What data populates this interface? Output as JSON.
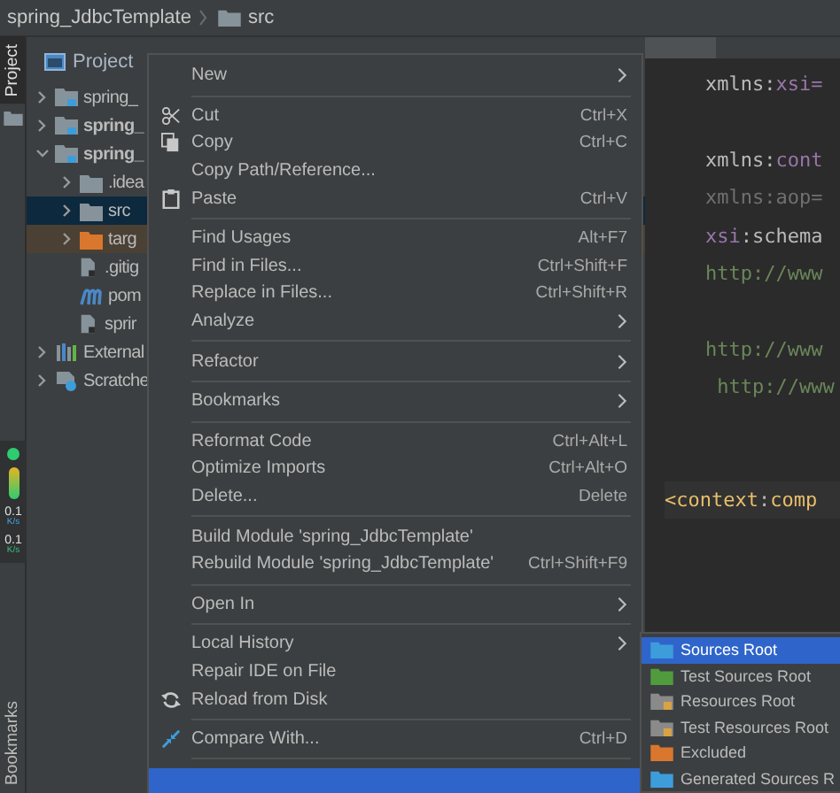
{
  "breadcrumb": [
    {
      "label": "spring_JdbcTemplate"
    },
    {
      "label": "src"
    }
  ],
  "side_strip": {
    "top_tab": {
      "label": "Project",
      "selected": true
    },
    "bottom_tab": {
      "label": "Bookmarks",
      "selected": false
    }
  },
  "net_widget": {
    "rates": [
      {
        "value": "0.1",
        "unit": "K/s"
      },
      {
        "value": "0.1",
        "unit": "K/s"
      }
    ]
  },
  "project_panel": {
    "title": "Project",
    "tree": [
      {
        "label": "spring_",
        "kind": "module",
        "bold": false,
        "expanded": false,
        "selected": false
      },
      {
        "label": "spring_",
        "kind": "module",
        "bold": true,
        "expanded": false,
        "selected": false
      },
      {
        "label": "spring_",
        "kind": "module",
        "bold": true,
        "expanded": true,
        "selected": false,
        "children": [
          {
            "label": ".idea",
            "kind": "folder",
            "bold": false,
            "expanded": false,
            "selected": false
          },
          {
            "label": "src",
            "kind": "folder",
            "bold": false,
            "expanded": false,
            "selected": true
          },
          {
            "label": "targ",
            "kind": "excluded",
            "bold": false,
            "expanded": false,
            "selected": false
          },
          {
            "label": ".gitig",
            "kind": "file",
            "bold": false,
            "selected": false
          },
          {
            "label": "pom",
            "kind": "maven",
            "bold": false,
            "selected": false
          },
          {
            "label": "sprir",
            "kind": "file",
            "bold": false,
            "selected": false
          }
        ]
      },
      {
        "label": "External",
        "kind": "libraries",
        "bold": false,
        "expanded": false,
        "selected": false
      },
      {
        "label": "Scratche",
        "kind": "scratches",
        "bold": false,
        "expanded": false,
        "selected": false
      }
    ]
  },
  "editor": {
    "blocks": [
      {
        "kind": "attrs",
        "lines": [
          [
            {
              "text": "xmlns:",
              "kind": "plain"
            },
            {
              "text": "xsi=",
              "kind": "ns"
            }
          ]
        ]
      },
      {
        "kind": "attrs",
        "lines": [
          [
            {
              "text": "xmlns:",
              "kind": "plain"
            },
            {
              "text": "cont",
              "kind": "ns"
            }
          ],
          [
            {
              "text": "xmlns:aop=",
              "kind": "dim"
            }
          ],
          [
            {
              "text": "xsi",
              "kind": "ns"
            },
            {
              "text": ":schema",
              "kind": "plain"
            }
          ],
          [
            {
              "text": "http://www",
              "kind": "url"
            }
          ]
        ]
      },
      {
        "kind": "attrs",
        "lines": [
          [
            {
              "text": "http://www",
              "kind": "url"
            }
          ],
          [
            {
              "text": " http://www",
              "kind": "url"
            }
          ]
        ]
      },
      {
        "kind": "tag",
        "lines": [
          [
            {
              "text": "<context",
              "kind": "tag"
            },
            {
              "text": ":",
              "kind": "plain"
            },
            {
              "text": "comp",
              "kind": "tag"
            }
          ]
        ]
      }
    ]
  },
  "context_menu": {
    "items": [
      {
        "kind": "plain",
        "label": "New",
        "submenu": true
      },
      {
        "kind": "separator"
      },
      {
        "kind": "scissors",
        "label": "Cut",
        "shortcut": "Ctrl+X",
        "submenu": false
      },
      {
        "kind": "copy",
        "label": "Copy",
        "shortcut": "Ctrl+C",
        "submenu": false
      },
      {
        "kind": "plain",
        "label": "Copy Path/Reference...",
        "submenu": false
      },
      {
        "kind": "clipboard",
        "label": "Paste",
        "shortcut": "Ctrl+V",
        "submenu": false
      },
      {
        "kind": "separator"
      },
      {
        "kind": "plain",
        "label": "Find Usages",
        "shortcut": "Alt+F7",
        "submenu": false
      },
      {
        "kind": "plain",
        "label": "Find in Files...",
        "shortcut": "Ctrl+Shift+F",
        "submenu": false
      },
      {
        "kind": "plain",
        "label": "Replace in Files...",
        "shortcut": "Ctrl+Shift+R",
        "submenu": false
      },
      {
        "kind": "plain",
        "label": "Analyze",
        "submenu": true
      },
      {
        "kind": "separator"
      },
      {
        "kind": "plain",
        "label": "Refactor",
        "submenu": true
      },
      {
        "kind": "separator"
      },
      {
        "kind": "plain",
        "label": "Bookmarks",
        "submenu": true
      },
      {
        "kind": "separator"
      },
      {
        "kind": "plain",
        "label": "Reformat Code",
        "shortcut": "Ctrl+Alt+L",
        "submenu": false
      },
      {
        "kind": "plain",
        "label": "Optimize Imports",
        "shortcut": "Ctrl+Alt+O",
        "submenu": false
      },
      {
        "kind": "plain",
        "label": "Delete...",
        "shortcut": "Delete",
        "submenu": false
      },
      {
        "kind": "separator"
      },
      {
        "kind": "plain",
        "label": "Build Module 'spring_JdbcTemplate'",
        "submenu": false
      },
      {
        "kind": "plain",
        "label": "Rebuild Module 'spring_JdbcTemplate'",
        "shortcut": "Ctrl+Shift+F9",
        "submenu": false
      },
      {
        "kind": "separator"
      },
      {
        "kind": "plain",
        "label": "Open In",
        "submenu": true
      },
      {
        "kind": "separator"
      },
      {
        "kind": "plain",
        "label": "Local History",
        "submenu": true
      },
      {
        "kind": "plain",
        "label": "Repair IDE on File",
        "submenu": false
      },
      {
        "kind": "reload",
        "label": "Reload from Disk",
        "submenu": false
      },
      {
        "kind": "separator"
      },
      {
        "kind": "compare",
        "label": "Compare With...",
        "shortcut": "Ctrl+D",
        "submenu": false
      },
      {
        "kind": "separator"
      },
      {
        "kind": "highlight"
      }
    ]
  },
  "submenu": {
    "items": [
      {
        "label": "Sources Root",
        "kind": "sources",
        "selected": true
      },
      {
        "label": "Test Sources Root",
        "kind": "test",
        "selected": false
      },
      {
        "label": "Resources Root",
        "kind": "resources",
        "selected": false
      },
      {
        "label": "Test Resources Root",
        "kind": "test-resources",
        "selected": false
      },
      {
        "label": "Excluded",
        "kind": "excluded",
        "selected": false
      },
      {
        "label": "Generated Sources R",
        "kind": "generated",
        "selected": false
      }
    ]
  }
}
